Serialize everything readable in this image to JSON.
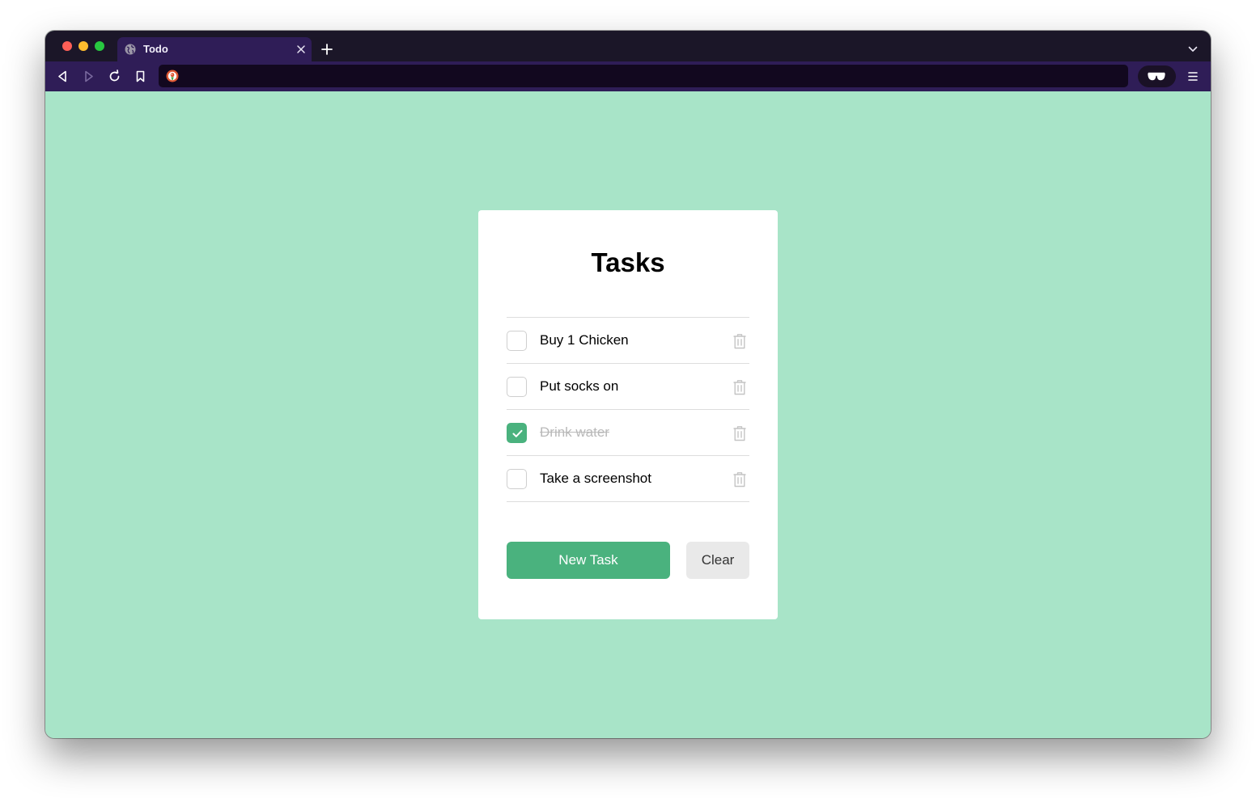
{
  "browser": {
    "tab": {
      "title": "Todo",
      "favicon": "globe-icon"
    },
    "toolbar": {
      "url_value": "",
      "url_placeholder": "",
      "shield_icon": "duckduckgo-icon",
      "privacy_icon": "sunglasses-icon"
    }
  },
  "app": {
    "title": "Tasks",
    "tasks": [
      {
        "label": "Buy 1 Chicken",
        "done": false
      },
      {
        "label": "Put socks on",
        "done": false
      },
      {
        "label": "Drink water",
        "done": true
      },
      {
        "label": "Take a screenshot",
        "done": false
      }
    ],
    "buttons": {
      "new_task": "New Task",
      "clear": "Clear"
    }
  },
  "colors": {
    "page_background": "#a8e4c8",
    "accent": "#4ab27e",
    "browser_chrome": "#2f1d57",
    "tabstrip": "#1b1628",
    "url_bar": "#12081f"
  }
}
